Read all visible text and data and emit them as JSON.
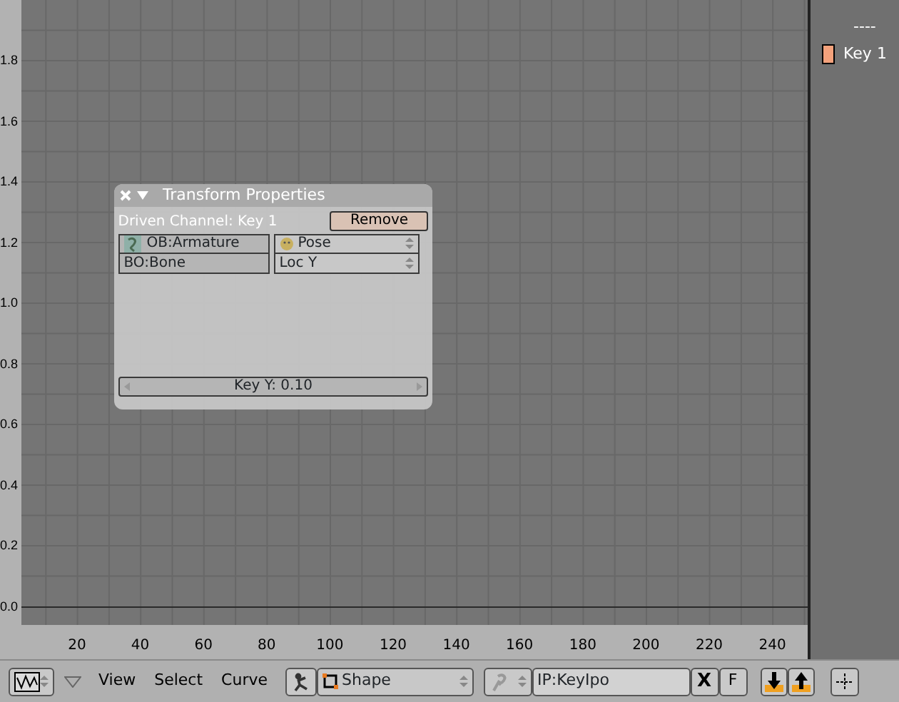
{
  "graph": {
    "y_ticks": [
      "1.8",
      "1.6",
      "1.4",
      "1.2",
      "1.0",
      "0.8",
      "0.6",
      "0.4",
      "0.2",
      "0.0"
    ],
    "x_ticks": [
      "20",
      "40",
      "60",
      "80",
      "100",
      "120",
      "140",
      "160",
      "180",
      "200",
      "220",
      "240"
    ]
  },
  "transform_panel": {
    "title": "Transform Properties",
    "expanded": true,
    "driven_channel": "Driven Channel: Key 1",
    "remove_button": "Remove",
    "object_field": "OB:Armature",
    "bone_field": "BO:Bone",
    "type_menu": "Pose",
    "channel_menu": "Loc Y",
    "value_field": "Key Y: 0.10"
  },
  "channel_list": {
    "separator": "----",
    "channels": [
      {
        "label": "Key 1",
        "color": "#f4a27c"
      }
    ]
  },
  "header": {
    "menus": [
      "View",
      "Select",
      "Curve"
    ],
    "mode_menu": "Shape",
    "ipo_field": "IP:KeyIpo",
    "clear_button": "X",
    "fake_user_button": "F"
  }
}
